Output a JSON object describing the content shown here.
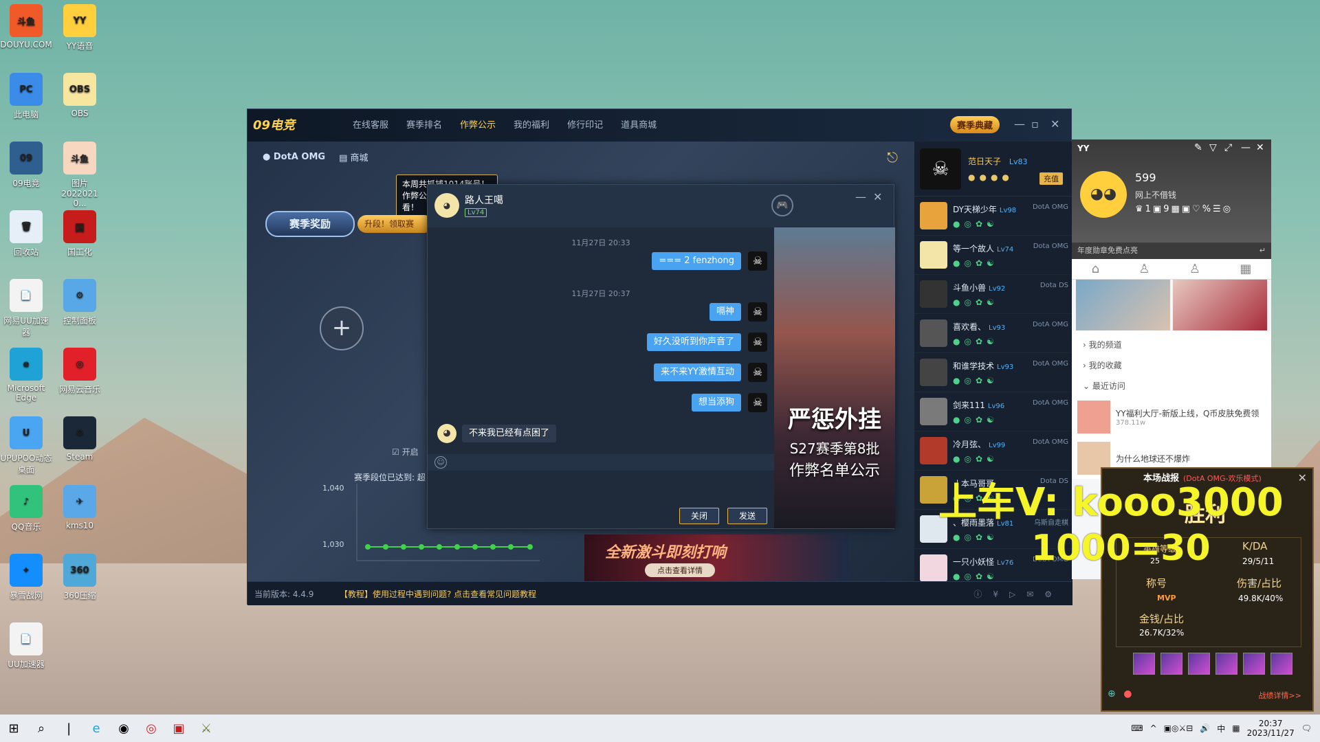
{
  "desktop": {
    "icons": [
      {
        "label": "DOUYU.COM",
        "sub": "斗鱼",
        "color": "#f05a28"
      },
      {
        "label": "YY语音",
        "sub": "YY",
        "color": "#ffcf3d"
      },
      {
        "label": "此电脑",
        "sub": "PC",
        "color": "#3b8be8"
      },
      {
        "label": "OBS",
        "sub": "OBS",
        "color": "#f7e6a0"
      },
      {
        "label": "09电竞",
        "sub": "09",
        "color": "#2f5f8f"
      },
      {
        "label": "图片\n2022021 0...",
        "sub": "斗鱼",
        "color": "#f7d7c0"
      },
      {
        "label": "回收站",
        "sub": "🗑",
        "color": "#e6eef8"
      },
      {
        "label": "国工化",
        "sub": "国",
        "color": "#c61c1c"
      },
      {
        "label": "网易UU加速器",
        "sub": "📄",
        "color": "#f3f3f3"
      },
      {
        "label": "控制面板",
        "sub": "⚙",
        "color": "#58a8e8"
      },
      {
        "label": "Microsoft Edge",
        "sub": "e",
        "color": "#1fa3d6"
      },
      {
        "label": "网易云音乐",
        "sub": "◎",
        "color": "#e1202a"
      },
      {
        "label": "UPUPOO动态桌面",
        "sub": "U",
        "color": "#4aa6f2"
      },
      {
        "label": "Steam",
        "sub": "⚙",
        "color": "#1b2838"
      },
      {
        "label": "QQ音乐",
        "sub": "♪",
        "color": "#31c27c"
      },
      {
        "label": "kms10",
        "sub": "✈",
        "color": "#5aa8e8"
      },
      {
        "label": "暴雪战网",
        "sub": "✦",
        "color": "#148eff"
      },
      {
        "label": "360压缩",
        "sub": "360",
        "color": "#4fa8d8"
      },
      {
        "label": "UU加速器",
        "sub": "📄",
        "color": "#f3f3f3"
      }
    ]
  },
  "client": {
    "logo": "09电竞",
    "nav": [
      "在线客服",
      "赛季排名",
      "作弊公示",
      "我的福利",
      "修行印记",
      "道具商城"
    ],
    "season_btn": "赛季典藏",
    "sub_items": [
      "DotA OMG",
      "商城"
    ],
    "tip": "本周共抓捕1014账号！作弊公示详情点击查看！",
    "reward_btn": "赛季奖励",
    "upgrade_btn": "升段！领取赛",
    "chart_title": "赛季段位已达到: 超",
    "open_label": "开启",
    "chart_y": [
      "1,040",
      "1,030"
    ],
    "banner_text": "全新激斗即刻打响",
    "banner_btn": "点击查看详情",
    "version": "当前版本: 4.4.9",
    "tutorial": "【教程】使用过程中遇到问题? 点击查看常见问题教程"
  },
  "friends": {
    "me": {
      "name": "范日天子",
      "level": "Lv83",
      "recharge": "充值"
    },
    "list": [
      {
        "name": "DY天梯少年",
        "level": "Lv98",
        "game": "DotA OMG",
        "color": "#e8a33c"
      },
      {
        "name": "等一个故人",
        "level": "Lv74",
        "game": "Dota OMG",
        "color": "#f3e4a8"
      },
      {
        "name": "斗鱼小兽",
        "level": "Lv92",
        "game": "Dota DS",
        "color": "#333"
      },
      {
        "name": "喜欢看、",
        "level": "Lv93",
        "game": "DotA OMG",
        "color": "#555"
      },
      {
        "name": "和谁学技术",
        "level": "Lv93",
        "game": "DotA OMG",
        "color": "#444"
      },
      {
        "name": "剑来111",
        "level": "Lv96",
        "game": "DotA OMG",
        "color": "#7a7a7a"
      },
      {
        "name": "冷月弦、",
        "level": "Lv99",
        "game": "DotA OMG",
        "color": "#b23a2a"
      },
      {
        "name": "丿本马哥哥",
        "level": "",
        "game": "Dota DS",
        "color": "#c9a238"
      },
      {
        "name": "、樱雨墨落",
        "level": "Lv81",
        "game": "乌斯自走棋",
        "color": "#dfe8ef"
      },
      {
        "name": "一只小妖怪",
        "level": "Lv76",
        "game": "DotA OMG",
        "color": "#f3d7e0"
      }
    ]
  },
  "chat": {
    "name": "路人王噶",
    "level": "Lv74",
    "messages": [
      {
        "type": "time",
        "text": "11月27日 20:33"
      },
      {
        "type": "out",
        "text": "=== 2 fenzhong"
      },
      {
        "type": "time",
        "text": "11月27日 20:37"
      },
      {
        "type": "out",
        "text": "嗝神"
      },
      {
        "type": "out",
        "text": "好久没听到你声音了"
      },
      {
        "type": "out",
        "text": "来不来YY激情互动"
      },
      {
        "type": "out",
        "text": "想当添狗"
      },
      {
        "type": "in",
        "text": "不来我已经有点困了"
      }
    ],
    "close_btn": "关闭",
    "send_btn": "发送",
    "ad": {
      "title": "严惩外挂",
      "line1": "S27赛季第8批",
      "line2": "作弊名单公示"
    }
  },
  "yy": {
    "label": "YY",
    "number": "599",
    "signature": "网上不借钱",
    "bar": "年度勋章免费点亮",
    "menu": [
      "我的频道",
      "我的收藏",
      "最近访问"
    ],
    "rec": [
      {
        "title": "YY福利大厅-新版上线，Q币皮肤免费领",
        "sub": "378.11w"
      },
      {
        "title": "为什么地球还不爆炸",
        "sub": ""
      }
    ]
  },
  "report": {
    "title": "本场战报",
    "tag": "(DotA OMG-欢乐模式)",
    "result": "胜利",
    "kda_label": "K/DA",
    "kda": "29/5/11",
    "title_label": "称号",
    "title_val": "MVP",
    "dmg_label": "伤害/占比",
    "dmg": "49.8K/40%",
    "gold_label": "金钱/占比",
    "gold": "26.7K/32%",
    "hero_label": "英雄等级",
    "hero_level": "25",
    "detail_link": "战绩详情>>"
  },
  "overlay": {
    "line1": "上车V: kooo3000",
    "line2": "1000=30"
  },
  "taskbar": {
    "time": "20:37",
    "date": "2023/11/27",
    "ime": "中"
  }
}
